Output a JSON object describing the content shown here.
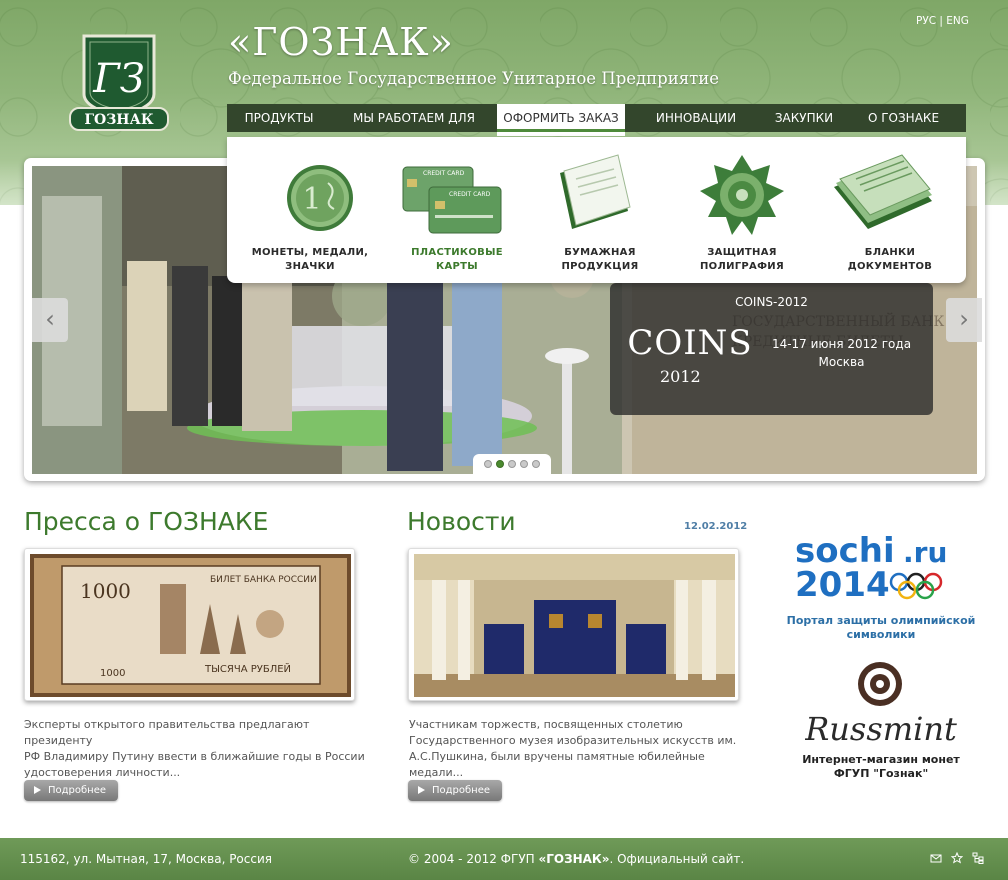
{
  "header": {
    "title": "«ГОЗНАК»",
    "subtitle": "Федеральное Государственное Унитарное Предприятие",
    "logo_text": "ГОЗНАК",
    "lang_ru": "РУС",
    "lang_sep": "|",
    "lang_en": "ENG"
  },
  "nav": {
    "items": [
      {
        "label": "ПРОДУКТЫ"
      },
      {
        "label": "МЫ РАБОТАЕМ ДЛЯ"
      },
      {
        "label": "ОФОРМИТЬ ЗАКАЗ"
      },
      {
        "label": "ИННОВАЦИИ"
      },
      {
        "label": "ЗАКУПКИ"
      },
      {
        "label": "О ГОЗНАКЕ"
      }
    ],
    "active_index": 2
  },
  "dropdown": {
    "items": [
      {
        "label_line1": "МОНЕТЫ, МЕДАЛИ,",
        "label_line2": "ЗНАЧКИ",
        "icon": "coin-icon"
      },
      {
        "label_line1": "ПЛАСТИКОВЫЕ",
        "label_line2": "КАРТЫ",
        "icon": "credit-card-icon",
        "card_text": "CREDIT CARD"
      },
      {
        "label_line1": "БУМАЖНАЯ",
        "label_line2": "ПРОДУКЦИЯ",
        "icon": "paper-icon"
      },
      {
        "label_line1": "ЗАЩИТНАЯ",
        "label_line2": "ПОЛИГРАФИЯ",
        "icon": "rosette-icon"
      },
      {
        "label_line1": "БЛАНКИ",
        "label_line2": "ДОКУМЕНТОВ",
        "icon": "documents-icon"
      }
    ]
  },
  "slider": {
    "caption_title": "COINS-2012",
    "caption_dates": "14-17 июня 2012 года",
    "caption_city": "Москва",
    "caption_logo": "COINS",
    "caption_logo_year": "2012",
    "slide_count": 5,
    "active_slide": 2,
    "prev_arrow": "‹",
    "next_arrow": "›"
  },
  "press": {
    "title": "Пресса о ГОЗНАКЕ",
    "banknote_denomination": "1000",
    "banknote_header": "БИЛЕТ БАНКА РОССИИ",
    "banknote_footer": "ТЫСЯЧА РУБЛЕЙ",
    "text": "Эксперты открытого правительства предлагают президенту РФ Владимиру Путину ввести в ближайшие годы в России удостоверения личности...",
    "text_line1": "Эксперты открытого правительства предлагают президенту",
    "text_line2": "РФ Владимиру Путину ввести в ближайшие годы в России",
    "text_line3": "удостоверения личности...",
    "more_label": "Подробнее"
  },
  "news": {
    "title": "Новости",
    "date": "12.02.2012",
    "text_line1": "Участникам торжеств, посвященных столетию",
    "text_line2": "Государственного музея изобразительных искусств им.",
    "text_line3": "А.С.Пушкина, были вручены памятные юбилейные медали...",
    "more_label": "Подробнее"
  },
  "sidebar": {
    "sochi_logo_line1": "sochi",
    "sochi_logo_ru": ".ru",
    "sochi_logo_line2": "2014",
    "sochi_label_line1": "Портал защиты олимпийской",
    "sochi_label_line2": "символики",
    "russmint_logo": "Russmint",
    "russmint_label_line1": "Интернет-магазин монет",
    "russmint_label_line2": "ФГУП \"Гознак\""
  },
  "footer": {
    "address": "115162, ул. Мытная, 17, Москва, Россия",
    "copyright_prefix": "© 2004 - 2012 ФГУП ",
    "copyright_brand": "«ГОЗНАК»",
    "copyright_suffix": ". Официальный сайт."
  },
  "colors": {
    "brand_green": "#3d7a2d",
    "nav_bg": "#33462c",
    "date_blue": "#4f7ea6",
    "sochi_blue": "#2c6fa6"
  }
}
